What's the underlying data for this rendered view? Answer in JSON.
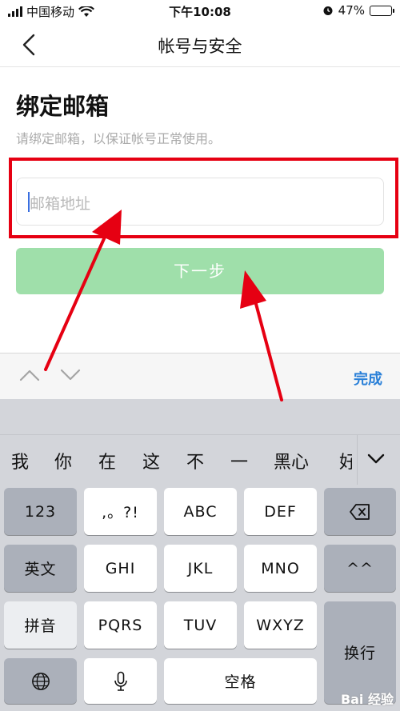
{
  "status_bar": {
    "carrier": "中国移动",
    "time": "下午10:08",
    "battery_text": "47%",
    "battery_level": 0.47
  },
  "nav": {
    "title": "帐号与安全"
  },
  "content": {
    "title": "绑定邮箱",
    "subtitle": "请绑定邮箱，以保证帐号正常使用。",
    "email_placeholder": "邮箱地址",
    "email_value": "",
    "next_label": "下一步"
  },
  "accessory_bar": {
    "done_label": "完成"
  },
  "keyboard": {
    "candidates": [
      "我",
      "你",
      "在",
      "这",
      "不",
      "一",
      "黑心",
      "好"
    ],
    "rows": {
      "row1": [
        "123",
        ",。?!",
        "ABC",
        "DEF"
      ],
      "row2": [
        "英文",
        "GHI",
        "JKL",
        "MNO",
        "^^"
      ],
      "row3": [
        "拼音",
        "PQRS",
        "TUV",
        "WXYZ"
      ],
      "return_label": "换行",
      "space_label": "空格"
    }
  },
  "watermark": "Bai 经验",
  "colors": {
    "accent_blue": "#2a80d8",
    "button_green": "#9fdfaa",
    "annotation_red": "#e60012"
  },
  "icons": [
    "back-chevron-icon",
    "chevron-up-icon",
    "chevron-down-icon",
    "delete-icon",
    "globe-icon",
    "microphone-icon",
    "expand-icon",
    "wifi-icon",
    "alarm-icon"
  ]
}
